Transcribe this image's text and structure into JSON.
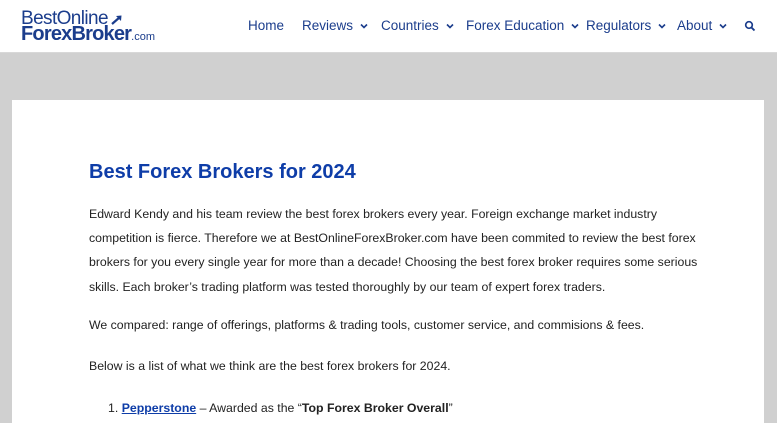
{
  "brand": {
    "line1": "BestOnline",
    "line2": "ForexBroker",
    "suffix": ".com",
    "color": "#1b3d8c"
  },
  "nav": {
    "items": [
      {
        "label": "Home",
        "has_dropdown": false
      },
      {
        "label": "Reviews",
        "has_dropdown": true
      },
      {
        "label": "Countries",
        "has_dropdown": true
      },
      {
        "label": "Forex Education",
        "has_dropdown": true
      },
      {
        "label": "Regulators",
        "has_dropdown": true
      },
      {
        "label": "About",
        "has_dropdown": true
      }
    ],
    "search_icon": "search-icon"
  },
  "article": {
    "title": "Best Forex Brokers for 2024",
    "paragraph1": "Edward Kendy and his team review the best forex brokers every year. Foreign exchange market industry competition is fierce. Therefore we at BestOnlineForexBroker.com have been commited to review the best forex brokers for you every single year for more than a decade! Choosing the best forex broker requires some serious skills. Each broker’s trading platform was tested thoroughly by our team of expert forex traders.",
    "paragraph2": "We compared: range of offerings, platforms & trading tools, customer service, and commisions & fees.",
    "paragraph3": "Below is a list of what we think are the best forex brokers for 2024.",
    "list": [
      {
        "number": "1.",
        "link": "Pepperstone",
        "separator": " – Awarded as the “",
        "award": "Top Forex Broker Overall",
        "closing": "”"
      }
    ]
  },
  "colors": {
    "accent": "#0e3da8",
    "page_bg": "#d0d0d0",
    "card_bg": "#ffffff"
  }
}
